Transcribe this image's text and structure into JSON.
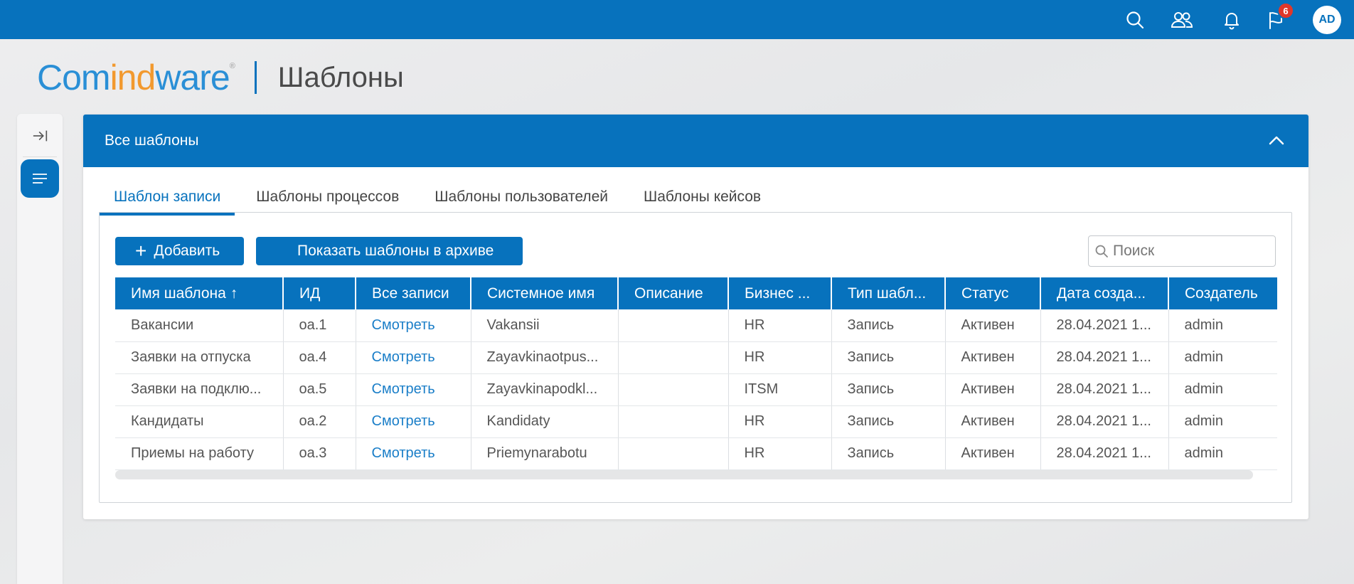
{
  "topbar": {
    "notifications_count": "6",
    "avatar_initials": "AD",
    "icons": [
      "search-icon",
      "users-icon",
      "bell-icon",
      "flag-icon"
    ]
  },
  "brand": {
    "logo_part1": "Com",
    "logo_part2": "ind",
    "logo_part3": "ware",
    "logo_mark": "®",
    "page_title": "Шаблоны"
  },
  "panel": {
    "title": "Все шаблоны"
  },
  "tabs": [
    {
      "label": "Шаблон записи",
      "active": true
    },
    {
      "label": "Шаблоны процессов",
      "active": false
    },
    {
      "label": "Шаблоны пользователей",
      "active": false
    },
    {
      "label": "Шаблоны кейсов",
      "active": false
    }
  ],
  "toolbar": {
    "add_label": "Добавить",
    "archive_label": "Показать шаблоны в архиве",
    "search_placeholder": "Поиск"
  },
  "table": {
    "columns": [
      "Имя шаблона",
      "ИД",
      "Все записи",
      "Системное имя",
      "Описание",
      "Бизнес ...",
      "Тип шабл...",
      "Статус",
      "Дата созда...",
      "Создатель"
    ],
    "sort_indicator": "↑",
    "rows": [
      [
        "Вакансии",
        "oa.1",
        "Смотреть",
        "Vakansii",
        "",
        "HR",
        "Запись",
        "Активен",
        "28.04.2021 1...",
        "admin"
      ],
      [
        "Заявки на отпуска",
        "oa.4",
        "Смотреть",
        "Zayavkinaotpus...",
        "",
        "HR",
        "Запись",
        "Активен",
        "28.04.2021 1...",
        "admin"
      ],
      [
        "Заявки на подклю...",
        "oa.5",
        "Смотреть",
        "Zayavkinapodkl...",
        "",
        "ITSM",
        "Запись",
        "Активен",
        "28.04.2021 1...",
        "admin"
      ],
      [
        "Кандидаты",
        "oa.2",
        "Смотреть",
        "Kandidaty",
        "",
        "HR",
        "Запись",
        "Активен",
        "28.04.2021 1...",
        "admin"
      ],
      [
        "Приемы на работу",
        "oa.3",
        "Смотреть",
        "Priemynarabotu",
        "",
        "HR",
        "Запись",
        "Активен",
        "28.04.2021 1...",
        "admin"
      ]
    ]
  },
  "colors": {
    "primary": "#0772bd",
    "badge": "#e0372a",
    "logo_blue": "#2a8fd6",
    "logo_orange": "#f2992e",
    "link": "#1a7ec8"
  }
}
